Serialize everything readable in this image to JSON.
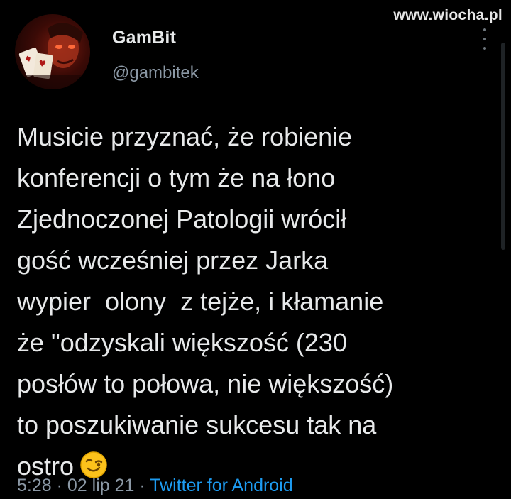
{
  "watermark": "www.wiocha.pl",
  "user": {
    "display_name": "GamBit",
    "handle": "@gambitek",
    "avatar_icon": "avatar-card-character"
  },
  "tweet": {
    "lines": [
      "Musicie przyznać, że robienie",
      "konferencji o tym że na łono",
      "Zjednoczonej Patologii wrócił",
      "gość wcześniej przez Jarka",
      "wypier  olony  z tejże, i kłamanie",
      "że \"odzyskali większość (230",
      "posłów to połowa, nie większość)",
      "to poszukiwanie sukcesu tak na",
      "ostro"
    ],
    "emoji": "winking-face-emoji"
  },
  "meta": {
    "time": "5:28",
    "separator1": " · ",
    "date": "02 lip 21",
    "separator2": " · ",
    "source": "Twitter for Android"
  },
  "colors": {
    "background": "#000000",
    "text": "#e7e9ea",
    "muted": "#8b98a5",
    "link": "#1d9bf0"
  }
}
